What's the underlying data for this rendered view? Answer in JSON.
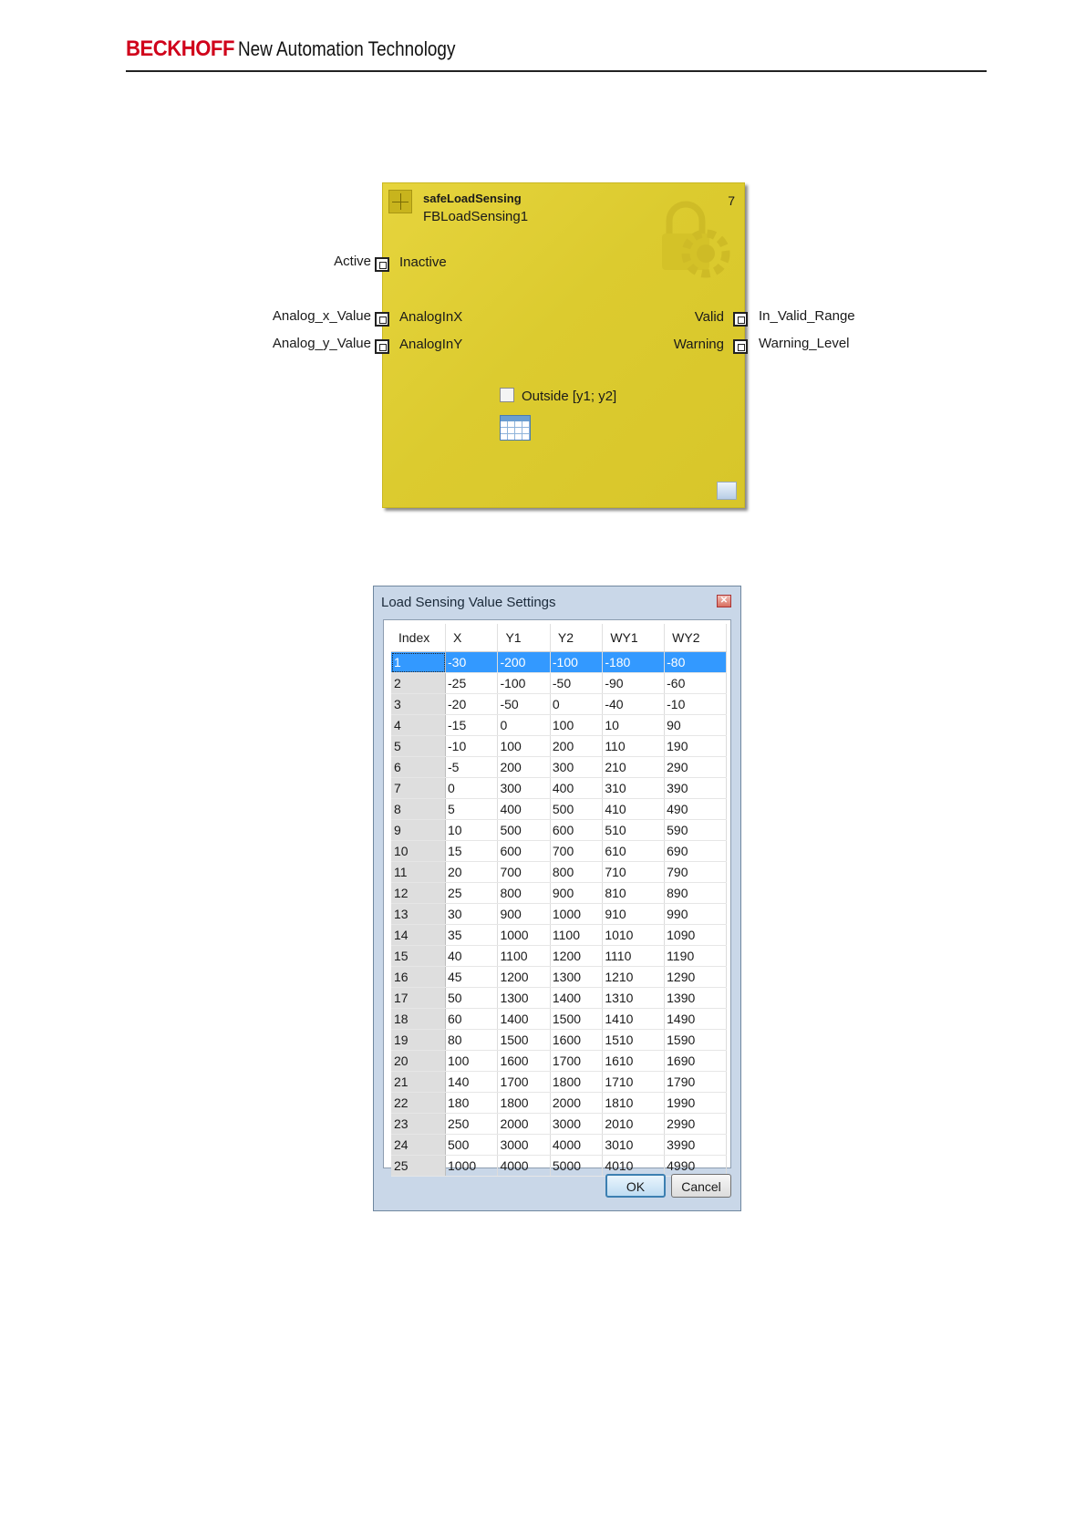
{
  "header": {
    "brand": "BECKHOFF",
    "tagline": "New Automation Technology"
  },
  "function_block": {
    "type_name": "safeLoadSensing",
    "instance_name": "FBLoadSensing1",
    "number": "7",
    "inputs": [
      {
        "external": "Active",
        "pin": "Inactive"
      },
      {
        "external": "Analog_x_Value",
        "pin": "AnalogInX"
      },
      {
        "external": "Analog_y_Value",
        "pin": "AnalogInY"
      }
    ],
    "outputs": [
      {
        "pin": "Valid",
        "external": "In_Valid_Range"
      },
      {
        "pin": "Warning",
        "external": "Warning_Level"
      }
    ],
    "option_label": "Outside [y1; y2]",
    "option_checked": false,
    "icons": {
      "block": "function-block-icon",
      "table": "table-icon",
      "collapse": "collapse-icon"
    }
  },
  "dialog": {
    "title": "Load Sensing Value Settings",
    "columns": [
      "Index",
      "X",
      "Y1",
      "Y2",
      "WY1",
      "WY2"
    ],
    "rows": [
      [
        "1",
        "-30",
        "-200",
        "-100",
        "-180",
        "-80"
      ],
      [
        "2",
        "-25",
        "-100",
        "-50",
        "-90",
        "-60"
      ],
      [
        "3",
        "-20",
        "-50",
        "0",
        "-40",
        "-10"
      ],
      [
        "4",
        "-15",
        "0",
        "100",
        "10",
        "90"
      ],
      [
        "5",
        "-10",
        "100",
        "200",
        "110",
        "190"
      ],
      [
        "6",
        "-5",
        "200",
        "300",
        "210",
        "290"
      ],
      [
        "7",
        "0",
        "300",
        "400",
        "310",
        "390"
      ],
      [
        "8",
        "5",
        "400",
        "500",
        "410",
        "490"
      ],
      [
        "9",
        "10",
        "500",
        "600",
        "510",
        "590"
      ],
      [
        "10",
        "15",
        "600",
        "700",
        "610",
        "690"
      ],
      [
        "11",
        "20",
        "700",
        "800",
        "710",
        "790"
      ],
      [
        "12",
        "25",
        "800",
        "900",
        "810",
        "890"
      ],
      [
        "13",
        "30",
        "900",
        "1000",
        "910",
        "990"
      ],
      [
        "14",
        "35",
        "1000",
        "1100",
        "1010",
        "1090"
      ],
      [
        "15",
        "40",
        "1100",
        "1200",
        "1110",
        "1190"
      ],
      [
        "16",
        "45",
        "1200",
        "1300",
        "1210",
        "1290"
      ],
      [
        "17",
        "50",
        "1300",
        "1400",
        "1310",
        "1390"
      ],
      [
        "18",
        "60",
        "1400",
        "1500",
        "1410",
        "1490"
      ],
      [
        "19",
        "80",
        "1500",
        "1600",
        "1510",
        "1590"
      ],
      [
        "20",
        "100",
        "1600",
        "1700",
        "1610",
        "1690"
      ],
      [
        "21",
        "140",
        "1700",
        "1800",
        "1710",
        "1790"
      ],
      [
        "22",
        "180",
        "1800",
        "2000",
        "1810",
        "1990"
      ],
      [
        "23",
        "250",
        "2000",
        "3000",
        "2010",
        "2990"
      ],
      [
        "24",
        "500",
        "3000",
        "4000",
        "3010",
        "3990"
      ],
      [
        "25",
        "1000",
        "4000",
        "5000",
        "4010",
        "4990"
      ]
    ],
    "selected_row": 0,
    "ok_label": "OK",
    "cancel_label": "Cancel"
  }
}
